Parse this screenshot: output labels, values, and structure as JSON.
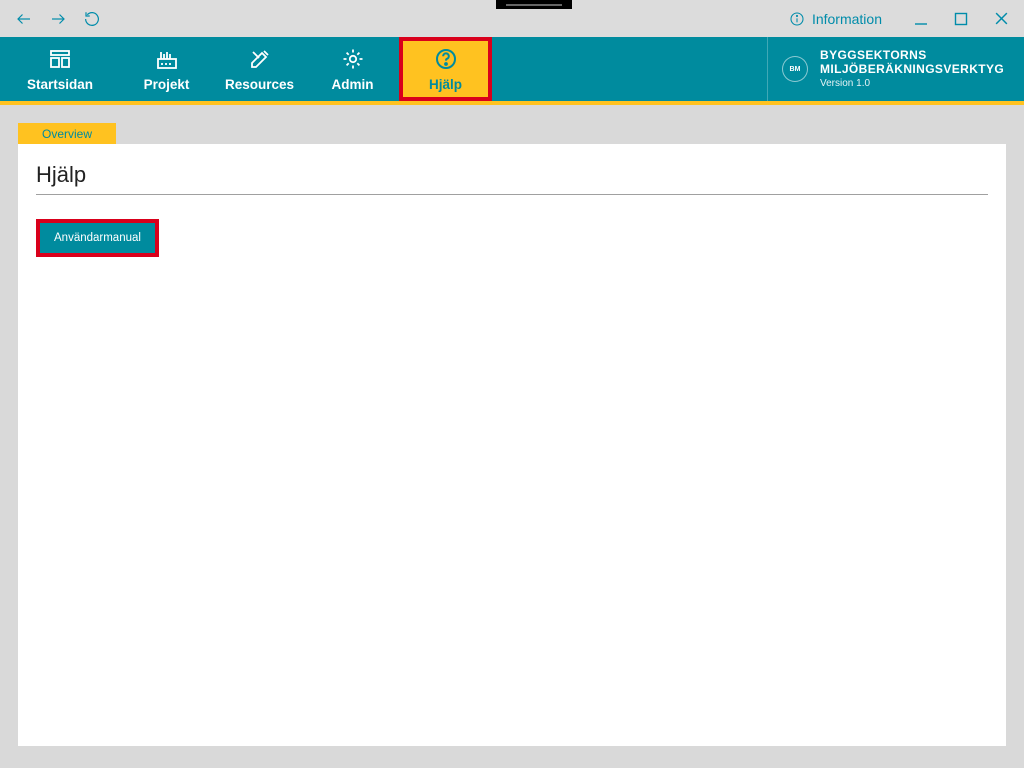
{
  "titlebar": {
    "information_label": "Information"
  },
  "nav": {
    "items": [
      {
        "label": "Startsidan"
      },
      {
        "label": "Projekt"
      },
      {
        "label": "Resources"
      },
      {
        "label": "Admin"
      },
      {
        "label": "Hjälp"
      }
    ]
  },
  "brand": {
    "badge": "BM",
    "line1": "BYGGSEKTORNS",
    "line2": "MILJÖBERÄKNINGSVERKTYG",
    "version": "Version 1.0"
  },
  "tabs": {
    "overview": "Overview"
  },
  "page": {
    "title": "Hjälp",
    "manual_button": "Användarmanual"
  }
}
